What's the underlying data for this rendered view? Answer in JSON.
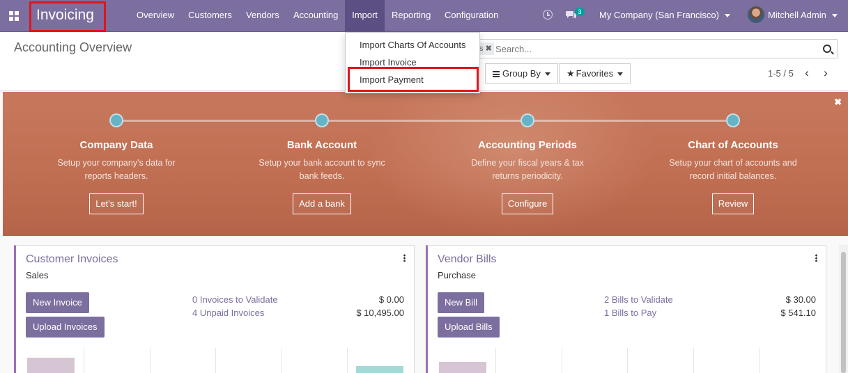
{
  "navbar": {
    "brand": "Invoicing",
    "menu": [
      "Overview",
      "Customers",
      "Vendors",
      "Accounting",
      "Import",
      "Reporting",
      "Configuration"
    ],
    "active_menu": "Import",
    "chat_count": "3",
    "company": "My Company (San Francisco)",
    "user": "Mitchell Admin"
  },
  "control_panel": {
    "title": "Accounting Overview",
    "search_facet_tail": "s",
    "search_placeholder": "Search...",
    "group_by": "Group By",
    "favorites": "Favorites",
    "pager": "1-5 / 5"
  },
  "import_dropdown": {
    "items": [
      "Import Charts Of Accounts",
      "Import Invoice",
      "Import Payment"
    ],
    "highlighted": "Import Payment"
  },
  "onboarding": {
    "steps": [
      {
        "title": "Company Data",
        "desc1": "Setup your company's data for",
        "desc2": "reports headers.",
        "button": "Let's start!"
      },
      {
        "title": "Bank Account",
        "desc1": "Setup your bank account to sync",
        "desc2": "bank feeds.",
        "button": "Add a bank"
      },
      {
        "title": "Accounting Periods",
        "desc1": "Define your fiscal years & tax",
        "desc2": "returns periodicity.",
        "button": "Configure"
      },
      {
        "title": "Chart of Accounts",
        "desc1": "Setup your chart of accounts and",
        "desc2": "record initial balances.",
        "button": "Review"
      }
    ]
  },
  "cards": [
    {
      "title": "Customer Invoices",
      "subtitle": "Sales",
      "buttons": [
        "New Invoice",
        "Upload Invoices"
      ],
      "stats": [
        {
          "label": "0 Invoices to Validate",
          "value": "$ 0.00"
        },
        {
          "label": "4 Unpaid Invoices",
          "value": "$ 10,495.00"
        }
      ]
    },
    {
      "title": "Vendor Bills",
      "subtitle": "Purchase",
      "buttons": [
        "New Bill",
        "Upload Bills"
      ],
      "stats": [
        {
          "label": "2 Bills to Validate",
          "value": "$ 30.00"
        },
        {
          "label": "1 Bills to Pay",
          "value": "$ 541.10"
        }
      ]
    }
  ],
  "colors": {
    "brand": "#7c6e9f",
    "highlight_box": "#e0151b",
    "banner": "#c7785c",
    "step_dot": "#67b3c6"
  }
}
